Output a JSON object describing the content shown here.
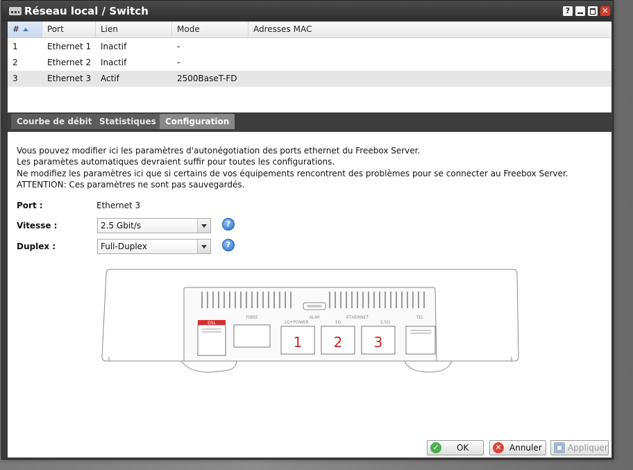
{
  "window": {
    "title": "Réseau local / Switch",
    "help": "?"
  },
  "table": {
    "columns": [
      "#",
      "Port",
      "Lien",
      "Mode",
      "Adresses MAC"
    ],
    "rows": [
      {
        "num": "1",
        "port": "Ethernet 1",
        "lien": "Inactif",
        "mode": "-",
        "mac": ""
      },
      {
        "num": "2",
        "port": "Ethernet 2",
        "lien": "Inactif",
        "mode": "-",
        "mac": ""
      },
      {
        "num": "3",
        "port": "Ethernet 3",
        "lien": "Actif",
        "mode": "2500BaseT-FD",
        "mac": ""
      }
    ]
  },
  "tabs": [
    "Courbe de débit",
    "Statistiques",
    "Configuration"
  ],
  "config": {
    "description": [
      "Vous pouvez modifier ici les paramètres d'autonégotiation des ports ethernet du Freebox Server.",
      "Les paramètes automatiques devraient suffir pour toutes les configurations.",
      "Ne modifiez les paramètres ici que si certains de vos équipements rencontrent des problèmes pour se connecter au Freebox Server.",
      "ATTENTION: Ces paramètres ne sont pas sauvegardés."
    ],
    "port_label": "Port :",
    "port_value": "Ethernet 3",
    "speed_label": "Vitesse :",
    "speed_value": "2.5 Gbit/s",
    "duplex_label": "Duplex :",
    "duplex_value": "Full-Duplex"
  },
  "device_labels": {
    "dsl": "DSL",
    "fibre": "FIBRE",
    "alim": "ALIM",
    "ethernet": "ETHERNET",
    "power": "1G+POWER",
    "g1": "1G",
    "g25": "2,5G",
    "tel": "TEL",
    "port1": "1",
    "port2": "2",
    "port3": "3"
  },
  "buttons": {
    "ok": "OK",
    "cancel": "Annuler",
    "apply": "Appliquer"
  },
  "colors": {
    "accent_red": "#c62828",
    "ok_green": "#4caf50",
    "cancel_red": "#d9453b"
  }
}
